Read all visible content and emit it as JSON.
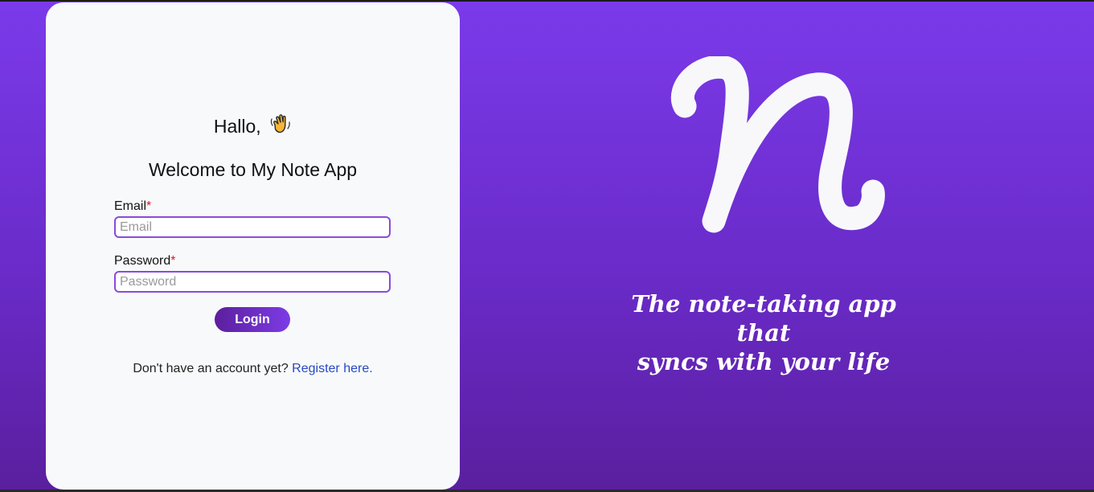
{
  "login_card": {
    "greeting": "Hallo,",
    "greeting_icon": "waving-hand-icon",
    "welcome": "Welcome to My Note App",
    "email": {
      "label": "Email",
      "required_mark": "*",
      "placeholder": "Email",
      "value": ""
    },
    "password": {
      "label": "Password",
      "required_mark": "*",
      "placeholder": "Password",
      "value": ""
    },
    "login_button": "Login",
    "register_prompt": "Don't have an account yet?",
    "register_link": "Register here."
  },
  "brand": {
    "logo_icon": "n-script-logo-icon",
    "tagline_line1": "The note-taking app that",
    "tagline_line2": "syncs with your life"
  },
  "colors": {
    "background_top": "#7b3aea",
    "background_bottom": "#5a1f9e",
    "card": "#f8f9fb",
    "input_border": "#8a4bd8",
    "required": "#d11a2a",
    "link": "#2649c2"
  }
}
